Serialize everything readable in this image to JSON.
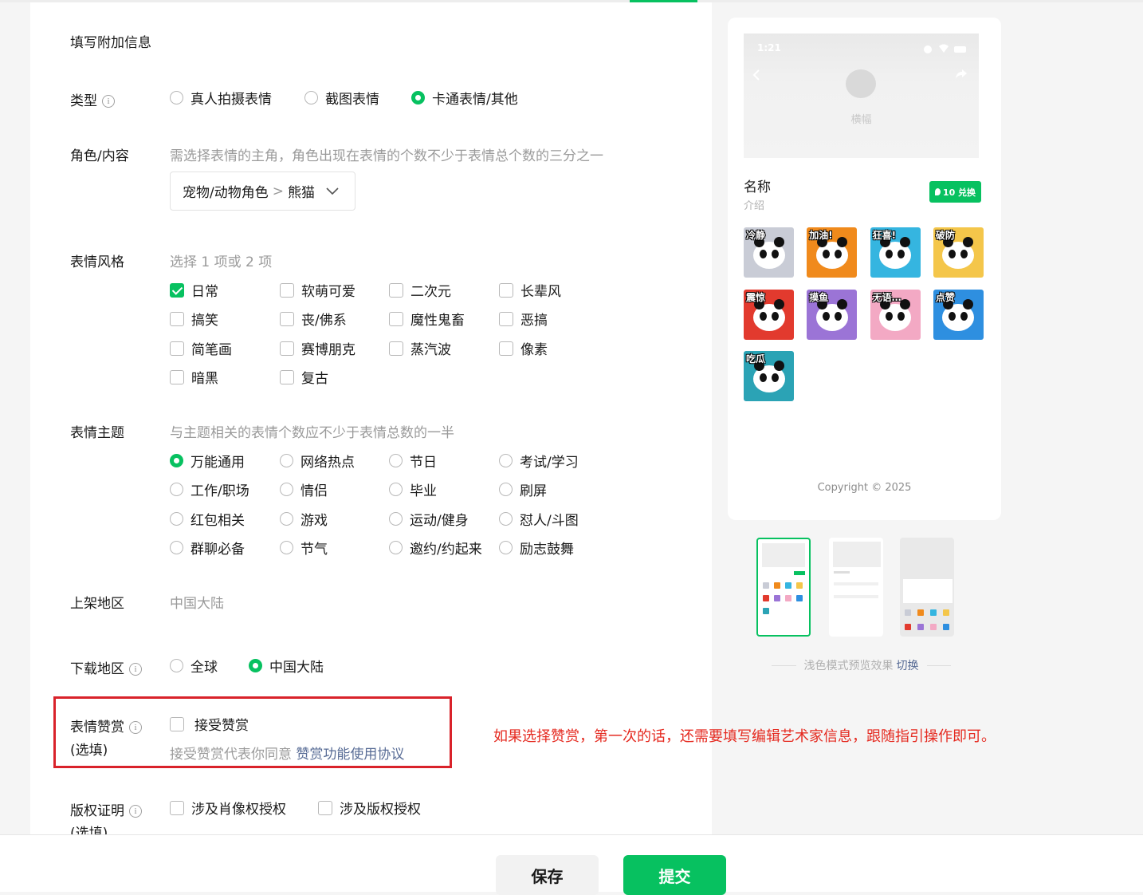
{
  "form": {
    "section_title": "填写附加信息",
    "type": {
      "label": "类型",
      "options": [
        "真人拍摄表情",
        "截图表情",
        "卡通表情/其他"
      ],
      "selected": "卡通表情/其他"
    },
    "role": {
      "label": "角色/内容",
      "hint": "需选择表情的主角，角色出现在表情的个数不少于表情总个数的三分之一",
      "select_category": "宠物/动物角色",
      "select_sep": ">",
      "select_value": "熊猫"
    },
    "style": {
      "label": "表情风格",
      "hint": "选择 1 项或 2 项",
      "options": [
        "日常",
        "软萌可爱",
        "二次元",
        "长辈风",
        "搞笑",
        "丧/佛系",
        "魔性鬼畜",
        "恶搞",
        "简笔画",
        "赛博朋克",
        "蒸汽波",
        "像素",
        "暗黑",
        "复古"
      ],
      "checked": [
        "日常"
      ]
    },
    "theme": {
      "label": "表情主题",
      "hint": "与主题相关的表情个数应不少于表情总数的一半",
      "options": [
        "万能通用",
        "网络热点",
        "节日",
        "考试/学习",
        "工作/职场",
        "情侣",
        "毕业",
        "刷屏",
        "红包相关",
        "游戏",
        "运动/健身",
        "怼人/斗图",
        "群聊必备",
        "节气",
        "邀约/约起来",
        "励志鼓舞"
      ],
      "selected": "万能通用"
    },
    "region": {
      "label": "上架地区",
      "value": "中国大陆"
    },
    "download": {
      "label": "下载地区",
      "options": [
        "全球",
        "中国大陆"
      ],
      "selected": "中国大陆"
    },
    "reward": {
      "label": "表情赞赏",
      "label_sub": "(选填)",
      "checkbox": "接受赞赏",
      "agree_text": "接受赞赏代表你同意 ",
      "agree_link": "赞赏功能使用协议"
    },
    "copyright": {
      "label": "版权证明",
      "label_sub": "(选填)",
      "options": [
        "涉及肖像权授权",
        "涉及版权授权"
      ]
    }
  },
  "annotation": "如果选择赞赏，第一次的话，还需要填写编辑艺术家信息，跟随指引操作即可。",
  "actions": {
    "save": "保存",
    "submit": "提交"
  },
  "preview": {
    "time": "1:21",
    "banner_text": "横幅",
    "name": "名称",
    "intro": "介绍",
    "badge": "10 兑换",
    "stickers": [
      "冷静",
      "加油!",
      "狂喜!",
      "破防",
      "震惊",
      "摸鱼",
      "无语…",
      "点赞",
      "吃瓜"
    ],
    "sticker_colors": [
      "#c9ccd6",
      "#f08a1c",
      "#35b5e0",
      "#f4c64a",
      "#e23a2e",
      "#9b74d6",
      "#f3a9c4",
      "#2e8fe0",
      "#2ba3b5"
    ],
    "copyright": "Copyright © 2025",
    "mode_text": "浅色模式预览效果",
    "mode_switch": "切换"
  },
  "colors": {
    "accent": "#07c160",
    "link": "#576b95",
    "annotation": "#e52a20"
  }
}
